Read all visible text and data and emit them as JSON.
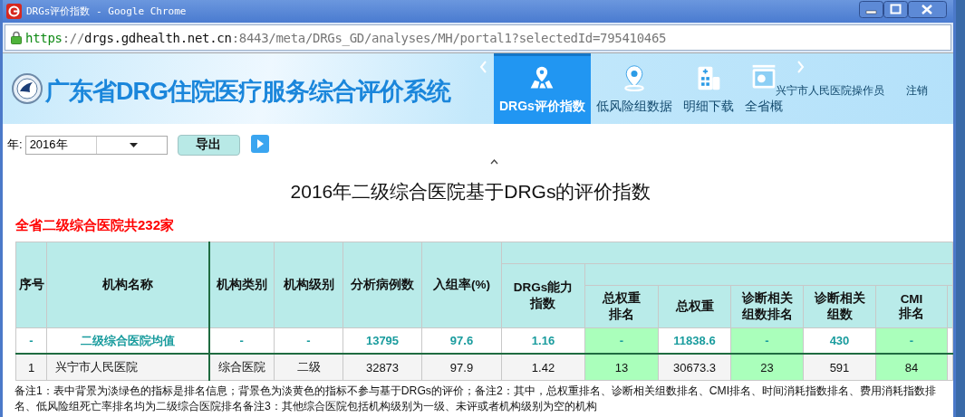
{
  "window": {
    "title": "DRGs评价指数 - Google Chrome"
  },
  "address_bar": {
    "url_parts": [
      {
        "text": "https",
        "kind": "scheme"
      },
      {
        "text": "://",
        "kind": "rest"
      },
      {
        "text": "drgs.gdhealth.net.cn",
        "kind": "host"
      },
      {
        "text": ":8443/meta/DRGs_GD/analyses/MH/portal1?selectedId=795410465",
        "kind": "rest"
      }
    ]
  },
  "header": {
    "title": "广东省DRG住院医疗服务综合评价系统",
    "nav": [
      {
        "label": "DRGs评价指数",
        "kind": "route",
        "selected": true
      },
      {
        "label": "低风险组数据",
        "kind": "pin",
        "selected": false
      },
      {
        "label": "明细下载",
        "kind": "building",
        "selected": false
      },
      {
        "label": "全省概",
        "kind": "screen",
        "selected": false
      }
    ],
    "user": "兴宁市人民医院操作员",
    "logout": "注销"
  },
  "toolbar": {
    "year_label": "年:",
    "year_value": "2016年",
    "export_button": "导出"
  },
  "report": {
    "title": "2016年二级综合医院基于DRGs的评价指数",
    "subtitle": "全省二级综合医院共232家",
    "columns": [
      {
        "label": "序号",
        "rank": false
      },
      {
        "label": "机构名称",
        "rank": false
      },
      {
        "label": "机构类别",
        "rank": false
      },
      {
        "label": "机构级别",
        "rank": false
      },
      {
        "label": "分析病例数",
        "rank": false
      },
      {
        "label": "入组率(%)",
        "rank": false
      },
      {
        "label": "DRGs能力指数",
        "rank": false
      },
      {
        "label": "总权重排名",
        "rank": true
      },
      {
        "label": "总权重",
        "rank": false
      },
      {
        "label": "诊断相关组数排名",
        "rank": true
      },
      {
        "label": "诊断相关组数",
        "rank": false
      },
      {
        "label": "CMI排名",
        "rank": true
      }
    ],
    "rows": [
      {
        "kind": "average",
        "cells": [
          "-",
          "二级综合医院均值",
          "-",
          "-",
          "13795",
          "97.6",
          "1.16",
          "-",
          "11838.6",
          "-",
          "430",
          "-"
        ]
      },
      {
        "kind": "hospital",
        "cells": [
          "1",
          "兴宁市人民医院",
          "综合医院",
          "二级",
          "32873",
          "97.9",
          "1.42",
          "13",
          "30673.3",
          "23",
          "591",
          "84"
        ]
      }
    ],
    "notes": "备注1：表中背景为淡绿色的指标是排名信息；背景色为淡黄色的指标不参与基于DRGs的评价；备注2：其中，总权重排名、诊断相关组数排名、CMI排名、时间消耗指数排名、费用消耗指数排名、低风险组死亡率排名均为二级综合医院排名备注3：其他综合医院包括机构级别为一级、未评或者机构级别为空的机构"
  }
}
